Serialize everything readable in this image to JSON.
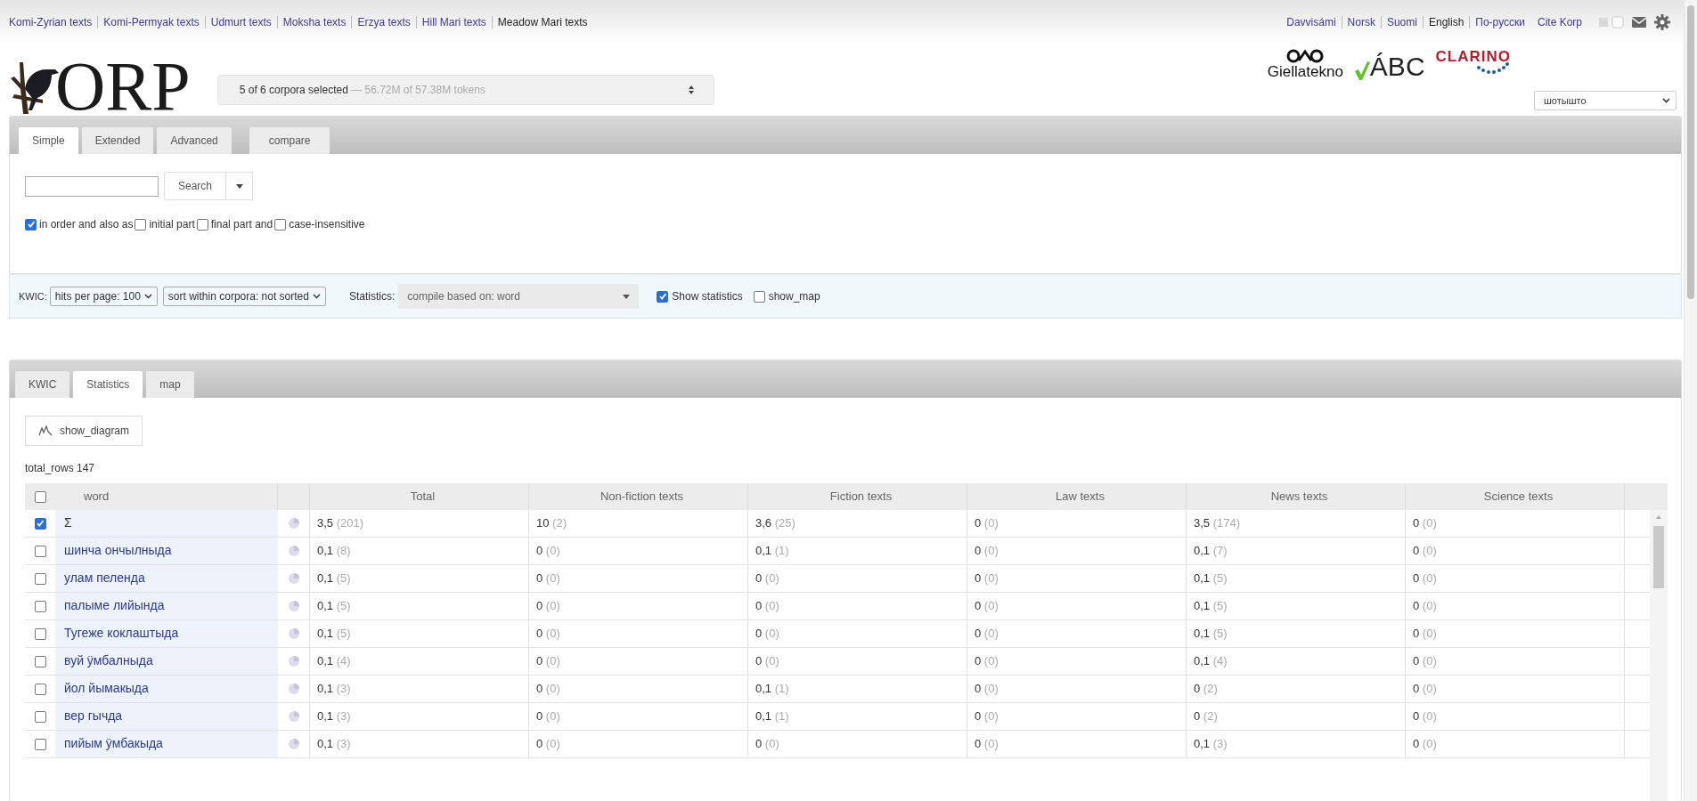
{
  "corpus_links": [
    {
      "label": "Komi-Zyrian texts",
      "selected": false
    },
    {
      "label": "Komi-Permyak texts",
      "selected": false
    },
    {
      "label": "Udmurt texts",
      "selected": false
    },
    {
      "label": "Moksha texts",
      "selected": false
    },
    {
      "label": "Erzya texts",
      "selected": false
    },
    {
      "label": "Hill Mari texts",
      "selected": false
    },
    {
      "label": "Meadow Mari texts",
      "selected": true
    }
  ],
  "language_links": [
    {
      "label": "Davvisámi",
      "selected": false
    },
    {
      "label": "Norsk",
      "selected": false
    },
    {
      "label": "Suomi",
      "selected": false
    },
    {
      "label": "English",
      "selected": true
    },
    {
      "label": "По-русски",
      "selected": false
    }
  ],
  "cite_link": "Cite Korp",
  "logo": {
    "text": "ORP"
  },
  "corpus_chooser": {
    "selected": "5 of 6 corpora selected",
    "tokens": "— 56.72M of 57.38M tokens"
  },
  "partner_logos": [
    {
      "kind": "giellatekno",
      "text": "Giellatekno"
    },
    {
      "kind": "abc",
      "text": "ÁBC"
    },
    {
      "kind": "clarino",
      "text": "CLARINO"
    }
  ],
  "language_select": {
    "value": "шотышто"
  },
  "search_tabs": [
    {
      "label": "Simple",
      "selected": true
    },
    {
      "label": "Extended",
      "selected": false
    },
    {
      "label": "Advanced",
      "selected": false
    },
    {
      "label": "compare",
      "selected": false
    }
  ],
  "search_button": "Search",
  "search_options": [
    {
      "label": "in order and also as",
      "checked": true
    },
    {
      "label": "initial part",
      "checked": false
    },
    {
      "label": "final part and",
      "checked": false
    },
    {
      "label": "case-insensitive",
      "checked": false
    }
  ],
  "options_bar": {
    "kwic_label": "KWIC:",
    "hits_select": "hits per page: 100",
    "sort_select": "sort within corpora: not sorted",
    "statistics_label": "Statistics:",
    "compile_select": "compile based on: word",
    "toggles": [
      {
        "label": "Show statistics",
        "checked": true
      },
      {
        "label": "show_map",
        "checked": false
      }
    ]
  },
  "result_tabs": [
    {
      "label": "KWIC",
      "selected": false
    },
    {
      "label": "Statistics",
      "selected": true
    },
    {
      "label": "map",
      "selected": false
    }
  ],
  "show_diagram_button": "show_diagram",
  "total_rows": "total_rows 147",
  "table": {
    "columns": [
      "word",
      "Total",
      "Non-fiction texts",
      "Fiction texts",
      "Law texts",
      "News texts",
      "Science texts"
    ],
    "header_checked": false,
    "rows": [
      {
        "word": "Σ",
        "checked": true,
        "cells": [
          {
            "value": "3,5",
            "count": "(201)"
          },
          {
            "value": "10",
            "count": "(2)"
          },
          {
            "value": "3,6",
            "count": "(25)"
          },
          {
            "value": "0",
            "count": "(0)"
          },
          {
            "value": "3,5",
            "count": "(174)"
          },
          {
            "value": "0",
            "count": "(0)"
          }
        ]
      },
      {
        "word": "шинча ончылныда",
        "checked": false,
        "cells": [
          {
            "value": "0,1",
            "count": "(8)"
          },
          {
            "value": "0",
            "count": "(0)"
          },
          {
            "value": "0,1",
            "count": "(1)"
          },
          {
            "value": "0",
            "count": "(0)"
          },
          {
            "value": "0,1",
            "count": "(7)"
          },
          {
            "value": "0",
            "count": "(0)"
          }
        ]
      },
      {
        "word": "улам пеленда",
        "checked": false,
        "cells": [
          {
            "value": "0,1",
            "count": "(5)"
          },
          {
            "value": "0",
            "count": "(0)"
          },
          {
            "value": "0",
            "count": "(0)"
          },
          {
            "value": "0",
            "count": "(0)"
          },
          {
            "value": "0,1",
            "count": "(5)"
          },
          {
            "value": "0",
            "count": "(0)"
          }
        ]
      },
      {
        "word": "палыме лийында",
        "checked": false,
        "cells": [
          {
            "value": "0,1",
            "count": "(5)"
          },
          {
            "value": "0",
            "count": "(0)"
          },
          {
            "value": "0",
            "count": "(0)"
          },
          {
            "value": "0",
            "count": "(0)"
          },
          {
            "value": "0,1",
            "count": "(5)"
          },
          {
            "value": "0",
            "count": "(0)"
          }
        ]
      },
      {
        "word": "Тугеже коклаштыда",
        "checked": false,
        "cells": [
          {
            "value": "0,1",
            "count": "(5)"
          },
          {
            "value": "0",
            "count": "(0)"
          },
          {
            "value": "0",
            "count": "(0)"
          },
          {
            "value": "0",
            "count": "(0)"
          },
          {
            "value": "0,1",
            "count": "(5)"
          },
          {
            "value": "0",
            "count": "(0)"
          }
        ]
      },
      {
        "word": "вуй ӱмбалныда",
        "checked": false,
        "cells": [
          {
            "value": "0,1",
            "count": "(4)"
          },
          {
            "value": "0",
            "count": "(0)"
          },
          {
            "value": "0",
            "count": "(0)"
          },
          {
            "value": "0",
            "count": "(0)"
          },
          {
            "value": "0,1",
            "count": "(4)"
          },
          {
            "value": "0",
            "count": "(0)"
          }
        ]
      },
      {
        "word": "йол йымакыда",
        "checked": false,
        "cells": [
          {
            "value": "0,1",
            "count": "(3)"
          },
          {
            "value": "0",
            "count": "(0)"
          },
          {
            "value": "0,1",
            "count": "(1)"
          },
          {
            "value": "0",
            "count": "(0)"
          },
          {
            "value": "0",
            "count": "(2)"
          },
          {
            "value": "0",
            "count": "(0)"
          }
        ]
      },
      {
        "word": "вер гычда",
        "checked": false,
        "cells": [
          {
            "value": "0,1",
            "count": "(3)"
          },
          {
            "value": "0",
            "count": "(0)"
          },
          {
            "value": "0,1",
            "count": "(1)"
          },
          {
            "value": "0",
            "count": "(0)"
          },
          {
            "value": "0",
            "count": "(2)"
          },
          {
            "value": "0",
            "count": "(0)"
          }
        ]
      },
      {
        "word": "пийым ӱмбакыда",
        "checked": false,
        "cells": [
          {
            "value": "0,1",
            "count": "(3)"
          },
          {
            "value": "0",
            "count": "(0)"
          },
          {
            "value": "0",
            "count": "(0)"
          },
          {
            "value": "0",
            "count": "(0)"
          },
          {
            "value": "0,1",
            "count": "(3)"
          },
          {
            "value": "0",
            "count": "(0)"
          }
        ]
      }
    ]
  }
}
